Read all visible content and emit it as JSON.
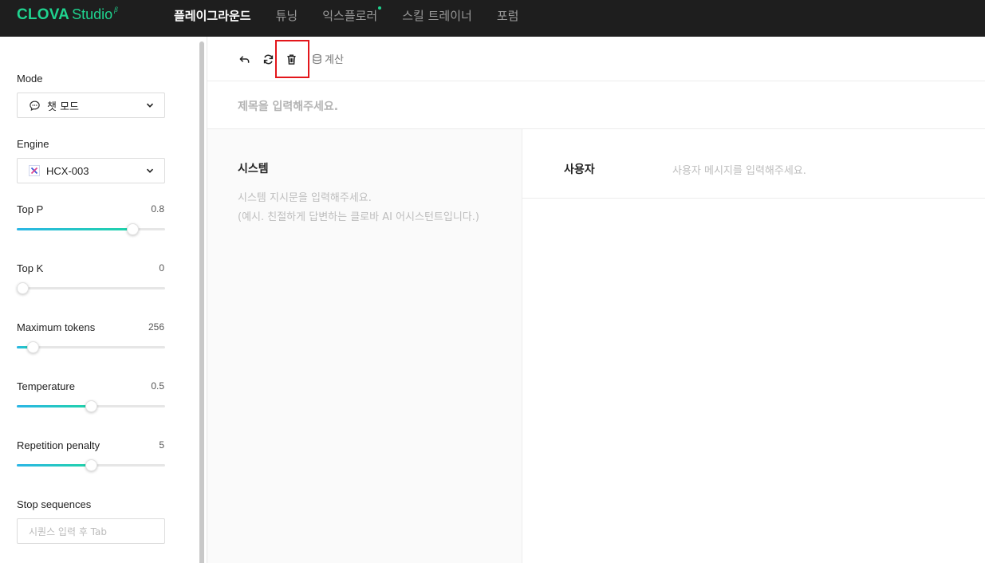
{
  "brand": {
    "name_bold": "CLOVA",
    "name_light": "Studio",
    "beta": "β",
    "color": "#1fd38f"
  },
  "nav": {
    "items": [
      {
        "label": "플레이그라운드",
        "active": true
      },
      {
        "label": "튜닝"
      },
      {
        "label": "익스플로러",
        "badge_dot": true
      },
      {
        "label": "스킬 트레이너"
      },
      {
        "label": "포럼"
      }
    ]
  },
  "sidebar": {
    "mode": {
      "label": "Mode",
      "value": "챗 모드",
      "icon": "chat-bubble-icon"
    },
    "engine": {
      "label": "Engine",
      "value": "HCX-003",
      "icon": "engine-logo-icon"
    },
    "sliders": [
      {
        "key": "top_p",
        "label": "Top P",
        "value": "0.8",
        "fraction": 0.78
      },
      {
        "key": "top_k",
        "label": "Top K",
        "value": "0",
        "fraction": 0.04
      },
      {
        "key": "max_tokens",
        "label": "Maximum tokens",
        "value": "256",
        "fraction": 0.105
      },
      {
        "key": "temperature",
        "label": "Temperature",
        "value": "0.5",
        "fraction": 0.5
      },
      {
        "key": "repetition",
        "label": "Repetition penalty",
        "value": "5",
        "fraction": 0.5
      }
    ],
    "stop": {
      "label": "Stop sequences",
      "placeholder": "시퀀스 입력 후 Tab"
    }
  },
  "toolbar": {
    "undo_icon": "undo-icon",
    "refresh_icon": "refresh-icon",
    "delete_icon": "trash-icon",
    "calc_label": "계산",
    "calc_icon": "database-icon",
    "highlight_color": "#e3161b"
  },
  "editor": {
    "title_placeholder": "제목을 입력해주세요.",
    "system": {
      "title": "시스템",
      "placeholder_line1": "시스템 지시문을 입력해주세요.",
      "placeholder_line2": "(예시. 친절하게 답변하는 클로바 AI 어시스턴트입니다.)"
    },
    "user": {
      "label": "사용자",
      "placeholder": "사용자 메시지를 입력해주세요."
    }
  }
}
